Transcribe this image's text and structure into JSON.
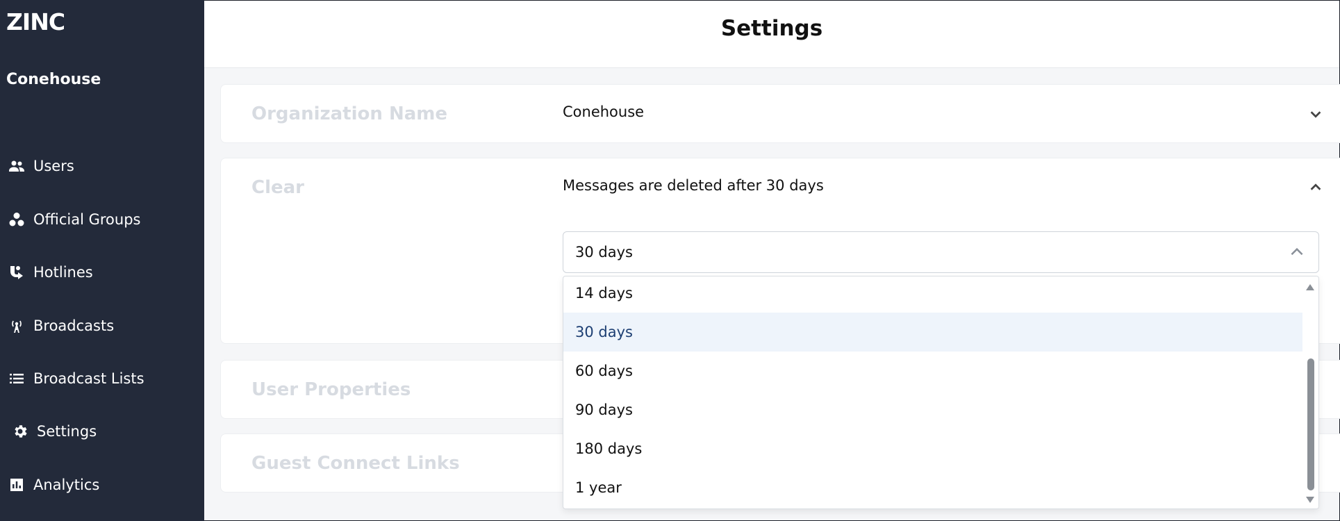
{
  "app": {
    "logo": "ZINC",
    "organization": "Conehouse"
  },
  "sidebar": {
    "items": [
      {
        "label": "Users",
        "icon": "users-icon"
      },
      {
        "label": "Official Groups",
        "icon": "groups-icon"
      },
      {
        "label": "Hotlines",
        "icon": "hotline-icon"
      },
      {
        "label": "Broadcasts",
        "icon": "broadcast-icon"
      },
      {
        "label": "Broadcast Lists",
        "icon": "list-icon"
      },
      {
        "label": "Settings",
        "icon": "gear-icon"
      },
      {
        "label": "Analytics",
        "icon": "analytics-icon"
      }
    ]
  },
  "header": {
    "title": "Settings"
  },
  "cards": {
    "org_name": {
      "label": "Organization Name",
      "value": "Conehouse"
    },
    "clear": {
      "label": "Clear",
      "value": "Messages are deleted after 30 days"
    },
    "user_properties": {
      "label": "User Properties"
    },
    "guest_links": {
      "label": "Guest Connect Links"
    }
  },
  "select": {
    "value": "30 days",
    "options": [
      "14 days",
      "30 days",
      "60 days",
      "90 days",
      "180 days",
      "1 year"
    ],
    "selected_index": 1
  },
  "colors": {
    "sidebar_bg": "#232a3a",
    "selected_bg": "#eef4fb",
    "selected_text": "#1d3f73",
    "label_muted": "#d7dbe1"
  }
}
